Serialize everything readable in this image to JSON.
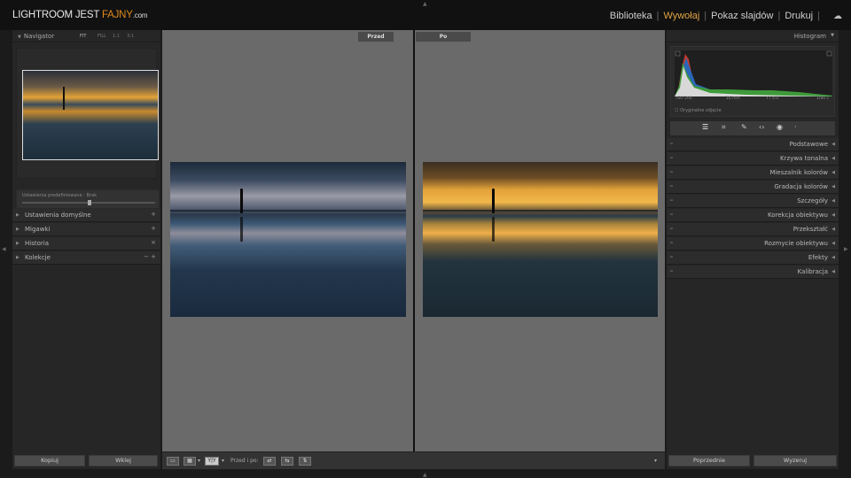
{
  "app": {
    "logo_main": "LIGHTROOM JEST ",
    "logo_highlight": "FAJNY",
    "logo_domain": ".com"
  },
  "modules": [
    "Biblioteka",
    "Wywołaj",
    "Pokaz slajdów",
    "Drukuj"
  ],
  "active_module": "Wywołaj",
  "left_panel": {
    "navigator_title": "Navigator",
    "navigator_zoom": "FIT",
    "navigator_options": [
      "FILL",
      "1:1",
      "3:1"
    ],
    "slider_label": "Ustawienia predefiniowane",
    "slider_value": "Brak",
    "sections": [
      {
        "label": "Ustawienia domyślne",
        "control": "+"
      },
      {
        "label": "Migawki",
        "control": "+"
      },
      {
        "label": "Historia",
        "control": "×"
      },
      {
        "label": "Kolekcje",
        "control": "− +"
      }
    ],
    "buttons": {
      "copy": "Kopiuj",
      "paste": "Wklej"
    }
  },
  "center": {
    "before_label": "Przed",
    "after_label": "Po",
    "toolbar_label": "Przed i po:",
    "toolbar_view": "Y|Y"
  },
  "right_panel": {
    "histogram_title": "Histogram",
    "histogram_stats": [
      "ISO 200",
      "16 mm",
      "f / 4.0",
      "1/80 s"
    ],
    "histogram_check": "Oryginalne zdjęcie",
    "sections": [
      "Podstawowe",
      "Krzywa tonalna",
      "Mieszalnik kolorów",
      "Gradacja kolorów",
      "Szczegóły",
      "Korekcja obiektywu",
      "Przekształć",
      "Rozmycie obiektywu",
      "Efekty",
      "Kalibracja"
    ],
    "buttons": {
      "previous": "Poprzednie",
      "reset": "Wyzeruj"
    }
  },
  "colors": {
    "accent": "#e0a342",
    "logo_highlight": "#e08a1e"
  }
}
